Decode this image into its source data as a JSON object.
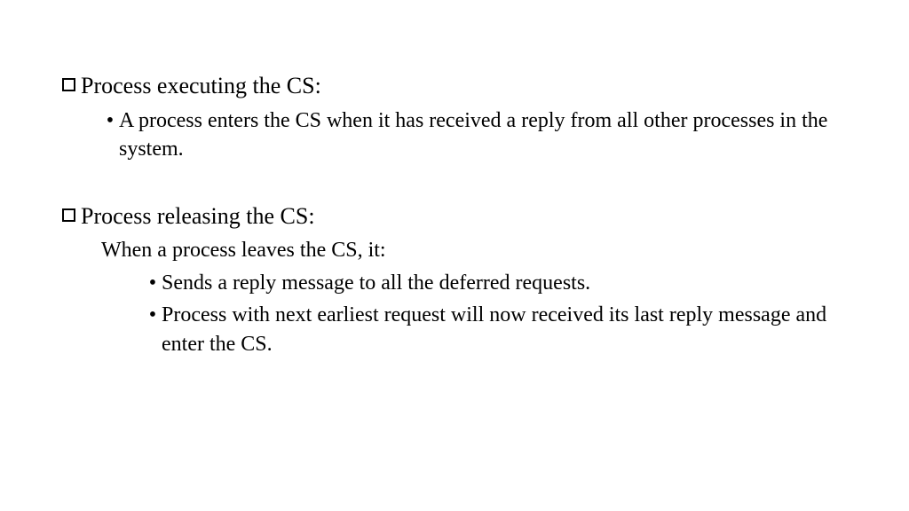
{
  "sections": [
    {
      "heading": "Process executing the CS:",
      "intro": null,
      "items": [
        "A process enters the CS when it has received a reply from all other processes in the system."
      ]
    },
    {
      "heading": "Process releasing the CS:",
      "intro": "When a process leaves the CS, it:",
      "items": [
        "Sends a reply message to all the deferred requests.",
        "Process with next earliest request will now received its last reply message and enter the CS."
      ]
    }
  ]
}
